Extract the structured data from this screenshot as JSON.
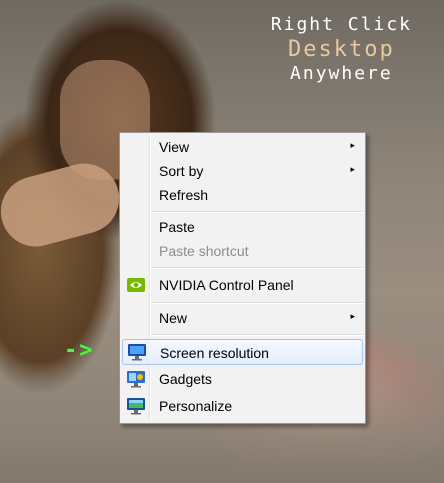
{
  "headline": {
    "line1": "Right Click",
    "line2": "Desktop",
    "line3": "Anywhere"
  },
  "arrow": "->",
  "menu": {
    "items": [
      {
        "label": "View",
        "submenu": "▸"
      },
      {
        "label": "Sort by",
        "submenu": "▸"
      },
      {
        "label": "Refresh"
      },
      {
        "label": "Paste"
      },
      {
        "label": "Paste shortcut",
        "disabled": true
      },
      {
        "label": "NVIDIA Control Panel",
        "icon": "nvidia-icon"
      },
      {
        "label": "New",
        "submenu": "▸"
      },
      {
        "label": "Screen resolution",
        "icon": "screen-resolution-icon",
        "highlighted": true
      },
      {
        "label": "Gadgets",
        "icon": "gadgets-icon"
      },
      {
        "label": "Personalize",
        "icon": "personalize-icon"
      }
    ]
  },
  "colors": {
    "arrow": "#3cff3c",
    "menu_bg": "#f2f2f2",
    "disabled_text": "#8d8d8d",
    "highlight_border": "#a8c4e8"
  }
}
